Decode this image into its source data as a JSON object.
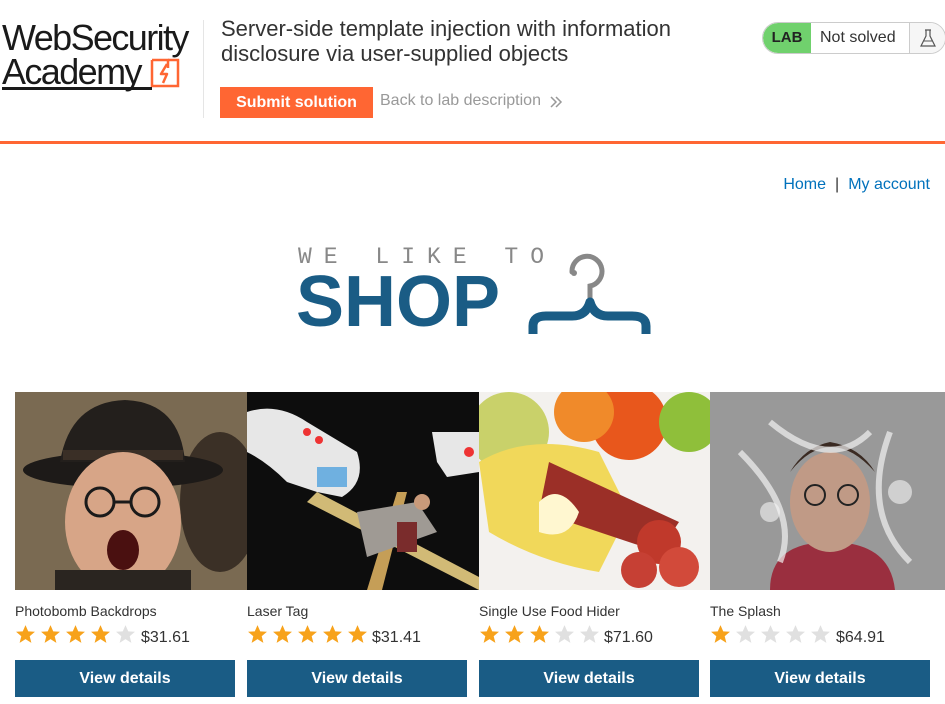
{
  "header": {
    "logo_line1": "WebSecurity",
    "logo_line2": "Academy",
    "lab_title": "Server-side template injection with information disclosure via user-supplied objects",
    "submit_label": "Submit solution",
    "back_label": "Back to lab description",
    "lab_badge": "LAB",
    "lab_status": "Not solved"
  },
  "nav": {
    "home": "Home",
    "separator": "|",
    "my_account": "My account"
  },
  "shop_logo": {
    "tagline": "WE LIKE TO",
    "word": "SHOP"
  },
  "products": [
    {
      "name": "Photobomb Backdrops",
      "stars": 4,
      "price": "$31.61",
      "button": "View details",
      "image": "man-in-hat-screaming-photo"
    },
    {
      "name": "Laser Tag",
      "stars": 5,
      "price": "$31.41",
      "button": "View details",
      "image": "laser-tag-guns-photo"
    },
    {
      "name": "Single Use Food Hider",
      "stars": 3,
      "price": "$71.60",
      "button": "View details",
      "image": "banana-peel-sausage-photo"
    },
    {
      "name": "The Splash",
      "stars": 1,
      "price": "$64.91",
      "button": "View details",
      "image": "woman-water-splash-photo"
    }
  ],
  "colors": {
    "accent": "#ff6633",
    "brand": "#1a5c85",
    "link": "#0071bc",
    "lab_badge": "#70d16d",
    "star_on": "#f7a21b",
    "star_off": "#e0e0e0"
  }
}
